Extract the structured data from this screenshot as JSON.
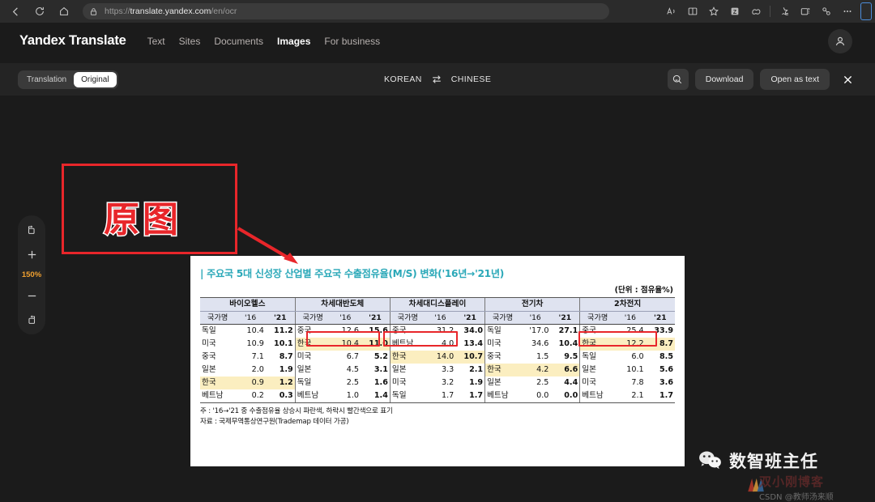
{
  "browser": {
    "back_icon": "back-arrow-icon",
    "refresh_icon": "refresh-icon",
    "home_icon": "home-icon",
    "lock_icon": "lock-icon",
    "url_scheme": "https://",
    "url_host": "translate.yandex.com",
    "url_path": "/en/ocr",
    "right_icons": [
      {
        "name": "read-aloud-icon",
        "glyph": "Aᴴ"
      },
      {
        "name": "split-screen-icon",
        "glyph": "◫"
      },
      {
        "name": "favorite-star-icon",
        "glyph": "☆"
      },
      {
        "name": "extension-icon",
        "glyph": "Z"
      },
      {
        "name": "copilot-icon",
        "glyph": "◌"
      },
      {
        "name": "collections-icon",
        "glyph": "☆"
      },
      {
        "name": "browser-essentials-icon",
        "glyph": "⊞"
      },
      {
        "name": "split-tab-icon",
        "glyph": "⚭"
      },
      {
        "name": "more-options-icon",
        "glyph": "…"
      }
    ]
  },
  "header": {
    "brand": "Yandex Translate",
    "nav": [
      {
        "label": "Text",
        "active": false
      },
      {
        "label": "Sites",
        "active": false
      },
      {
        "label": "Documents",
        "active": false
      },
      {
        "label": "Images",
        "active": true
      },
      {
        "label": "For business",
        "active": false
      }
    ],
    "avatar_icon": "user-avatar-icon"
  },
  "toolbar": {
    "tabs": [
      {
        "label": "Translation",
        "active": false
      },
      {
        "label": "Original",
        "active": true
      }
    ],
    "source_language": "KOREAN",
    "swap_icon": "swap-languages-icon",
    "target_language": "CHINESE",
    "feedback_icon": "feedback-icon",
    "download_label": "Download",
    "open_as_text_label": "Open as text",
    "close_icon": "close-icon"
  },
  "zoom_rail": {
    "rotate_left_icon": "rotate-left-icon",
    "zoom_in_icon": "plus-icon",
    "zoom_level": "150%",
    "zoom_out_icon": "minus-icon",
    "rotate_right_icon": "rotate-right-icon"
  },
  "annotation": {
    "label": "原图",
    "color": "#e8262a",
    "arrow_icon": "arrow-pointer-icon"
  },
  "document": {
    "title": "| 주요국 5대 신성장 산업별 주요국 수출점유율(M/S) 변화('16년→'21년)",
    "title_color": "#2aa8b8",
    "unit_note": "(단위 : 점유율%)",
    "col_country": "국가명",
    "col_y16": "'16",
    "col_y21": "'21",
    "notes": [
      "주 : '16→'21 중 수출점유율 상승시 파란색, 하락시 빨간색으로 표기",
      "자료 : 국제무역통상연구원(Trademap 데이터 가공)"
    ]
  },
  "chart_data": {
    "type": "table",
    "title": "| 주요국 5대 신성장 산업별 주요국 수출점유율(M/S) 변화('16년→'21년)",
    "unit": "점유율%",
    "column_groups": [
      "바이오헬스",
      "차세대반도체",
      "차세대디스플레이",
      "전기차",
      "2차전지"
    ],
    "sub_headers": [
      "국가명",
      "'16",
      "'21"
    ],
    "groups": [
      {
        "name": "바이오헬스",
        "rows": [
          {
            "country": "독일",
            "y16": "10.4",
            "y21": "11.2",
            "trend": "up",
            "kr": false,
            "highlight": false
          },
          {
            "country": "미국",
            "y16": "10.9",
            "y21": "10.1",
            "trend": "down",
            "kr": false,
            "highlight": false
          },
          {
            "country": "중국",
            "y16": "7.1",
            "y21": "8.7",
            "trend": "down",
            "kr": false,
            "highlight": false
          },
          {
            "country": "일본",
            "y16": "2.0",
            "y21": "1.9",
            "trend": "down",
            "kr": false,
            "highlight": false
          },
          {
            "country": "한국",
            "y16": "0.9",
            "y21": "1.2",
            "trend": "up",
            "kr": true,
            "highlight": false
          },
          {
            "country": "베트남",
            "y16": "0.2",
            "y21": "0.3",
            "trend": "up",
            "kr": false,
            "highlight": false
          }
        ]
      },
      {
        "name": "차세대반도체",
        "rows": [
          {
            "country": "중국",
            "y16": "12.6",
            "y21": "15.6",
            "trend": "up",
            "kr": false,
            "highlight": true
          },
          {
            "country": "한국",
            "y16": "10.4",
            "y21": "11.0",
            "trend": "up",
            "kr": true,
            "highlight": false
          },
          {
            "country": "미국",
            "y16": "6.7",
            "y21": "5.2",
            "trend": "down",
            "kr": false,
            "highlight": false
          },
          {
            "country": "일본",
            "y16": "4.5",
            "y21": "3.1",
            "trend": "down",
            "kr": false,
            "highlight": false
          },
          {
            "country": "독일",
            "y16": "2.5",
            "y21": "1.6",
            "trend": "down",
            "kr": false,
            "highlight": false
          },
          {
            "country": "베트남",
            "y16": "1.0",
            "y21": "1.4",
            "trend": "up",
            "kr": false,
            "highlight": false
          }
        ]
      },
      {
        "name": "차세대디스플레이",
        "rows": [
          {
            "country": "중국",
            "y16": "31.2",
            "y21": "34.0",
            "trend": "up",
            "kr": false,
            "highlight": true
          },
          {
            "country": "베트남",
            "y16": "4.0",
            "y21": "13.4",
            "trend": "up",
            "kr": false,
            "highlight": false
          },
          {
            "country": "한국",
            "y16": "14.0",
            "y21": "10.7",
            "trend": "down",
            "kr": true,
            "highlight": false
          },
          {
            "country": "일본",
            "y16": "3.3",
            "y21": "2.1",
            "trend": "down",
            "kr": false,
            "highlight": false
          },
          {
            "country": "미국",
            "y16": "3.2",
            "y21": "1.9",
            "trend": "down",
            "kr": false,
            "highlight": false
          },
          {
            "country": "독일",
            "y16": "1.7",
            "y21": "1.7",
            "trend": "flat",
            "kr": false,
            "highlight": false
          }
        ]
      },
      {
        "name": "전기차",
        "rows": [
          {
            "country": "독일",
            "y16": "'17.0",
            "y21": "27.1",
            "trend": "up",
            "kr": false,
            "highlight": false
          },
          {
            "country": "미국",
            "y16": "34.6",
            "y21": "10.4",
            "trend": "down",
            "kr": false,
            "highlight": false
          },
          {
            "country": "중국",
            "y16": "1.5",
            "y21": "9.5",
            "trend": "up",
            "kr": false,
            "highlight": false
          },
          {
            "country": "한국",
            "y16": "4.2",
            "y21": "6.6",
            "trend": "up",
            "kr": true,
            "highlight": false
          },
          {
            "country": "일본",
            "y16": "2.5",
            "y21": "4.4",
            "trend": "up",
            "kr": false,
            "highlight": false
          },
          {
            "country": "베트남",
            "y16": "0.0",
            "y21": "0.0",
            "trend": "flat",
            "kr": false,
            "highlight": false
          }
        ]
      },
      {
        "name": "2차전지",
        "rows": [
          {
            "country": "중국",
            "y16": "25.4",
            "y21": "33.9",
            "trend": "up",
            "kr": false,
            "highlight": true
          },
          {
            "country": "한국",
            "y16": "12.2",
            "y21": "8.7",
            "trend": "down",
            "kr": true,
            "highlight": false
          },
          {
            "country": "독일",
            "y16": "6.0",
            "y21": "8.5",
            "trend": "up",
            "kr": false,
            "highlight": false
          },
          {
            "country": "일본",
            "y16": "10.1",
            "y21": "5.6",
            "trend": "down",
            "kr": false,
            "highlight": false
          },
          {
            "country": "미국",
            "y16": "7.8",
            "y21": "3.6",
            "trend": "down",
            "kr": false,
            "highlight": false
          },
          {
            "country": "베트남",
            "y16": "2.1",
            "y21": "1.7",
            "trend": "down",
            "kr": false,
            "highlight": false
          }
        ]
      }
    ],
    "legend": {
      "up_color": "#1020d8",
      "down_color": "#e01b1b",
      "up_meaning": "상승시 파란색",
      "down_meaning": "하락시 빨간색"
    }
  },
  "watermarks": {
    "wechat_icon": "wechat-icon",
    "wechat_name": "数智班主任",
    "csdn_title": "双小刚博客",
    "csdn_sub": "CSDN @教师汤来顺"
  }
}
